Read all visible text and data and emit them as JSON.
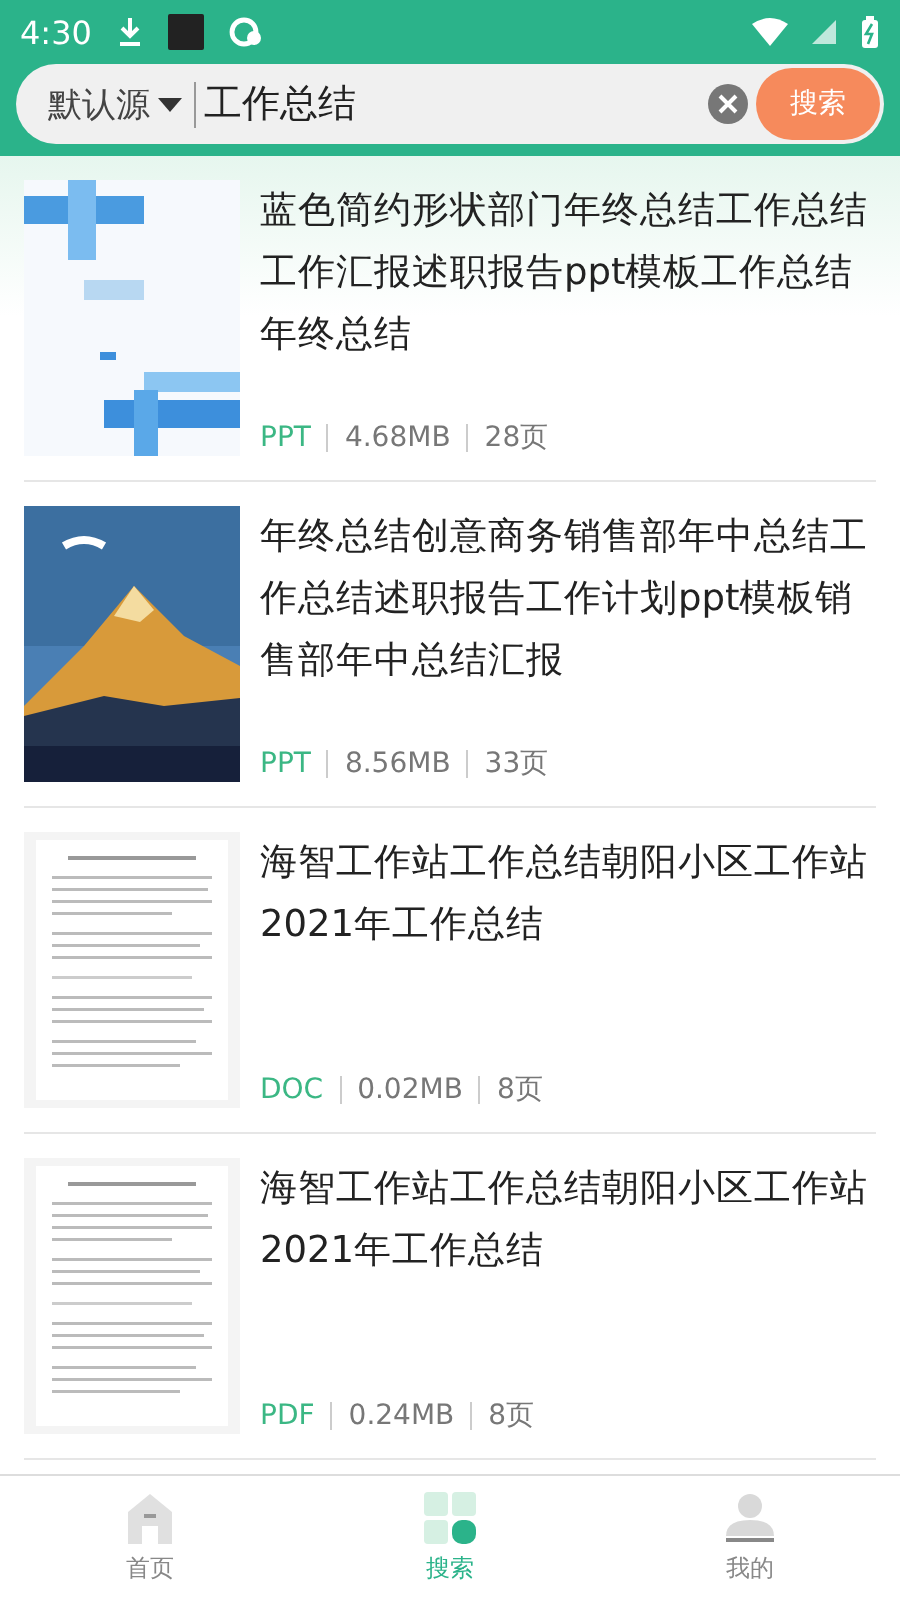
{
  "status_bar": {
    "time": "4:30"
  },
  "search": {
    "source": "默认源",
    "value": "工作总结",
    "button": "搜索"
  },
  "results": [
    {
      "title": "蓝色简约形状部门年终总结工作总结工作汇报述职报告ppt模板工作总结年终总结",
      "type": "PPT",
      "size": "4.68MB",
      "pages": "28页"
    },
    {
      "title": "年终总结创意商务销售部年中总结工作总结述职报告工作计划ppt模板销售部年中总结汇报",
      "type": "PPT",
      "size": "8.56MB",
      "pages": "33页"
    },
    {
      "title": "海智工作站工作总结朝阳小区工作站2021年工作总结",
      "type": "DOC",
      "size": "0.02MB",
      "pages": "8页"
    },
    {
      "title": "海智工作站工作总结朝阳小区工作站2021年工作总结",
      "type": "PDF",
      "size": "0.24MB",
      "pages": "8页"
    }
  ],
  "tabs": [
    {
      "label": "首页",
      "kind": "home",
      "selected": false
    },
    {
      "label": "搜索",
      "kind": "search",
      "selected": true
    },
    {
      "label": "我的",
      "kind": "profile",
      "selected": false
    }
  ]
}
